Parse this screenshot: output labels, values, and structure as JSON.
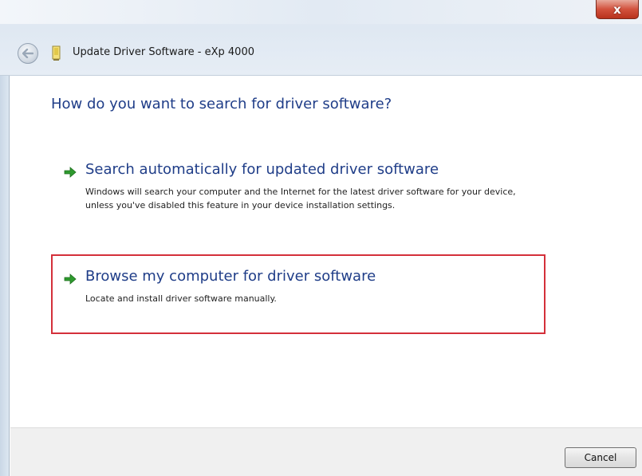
{
  "window": {
    "title": "Update Driver Software - eXp 4000",
    "close_label": "x"
  },
  "main": {
    "heading": "How do you want to search for driver software?",
    "options": [
      {
        "title": "Search automatically for updated driver software",
        "description": "Windows will search your computer and the Internet for the latest driver software for your device, unless you've disabled this feature in your device installation settings.",
        "icon": "green-arrow-icon"
      },
      {
        "title": "Browse my computer for driver software",
        "description": "Locate and install driver software manually.",
        "icon": "green-arrow-icon"
      }
    ]
  },
  "footer": {
    "cancel_label": "Cancel"
  },
  "colors": {
    "heading_blue": "#1f3d88",
    "highlight_red": "#d4303a",
    "arrow_green": "#2e9a2e"
  }
}
